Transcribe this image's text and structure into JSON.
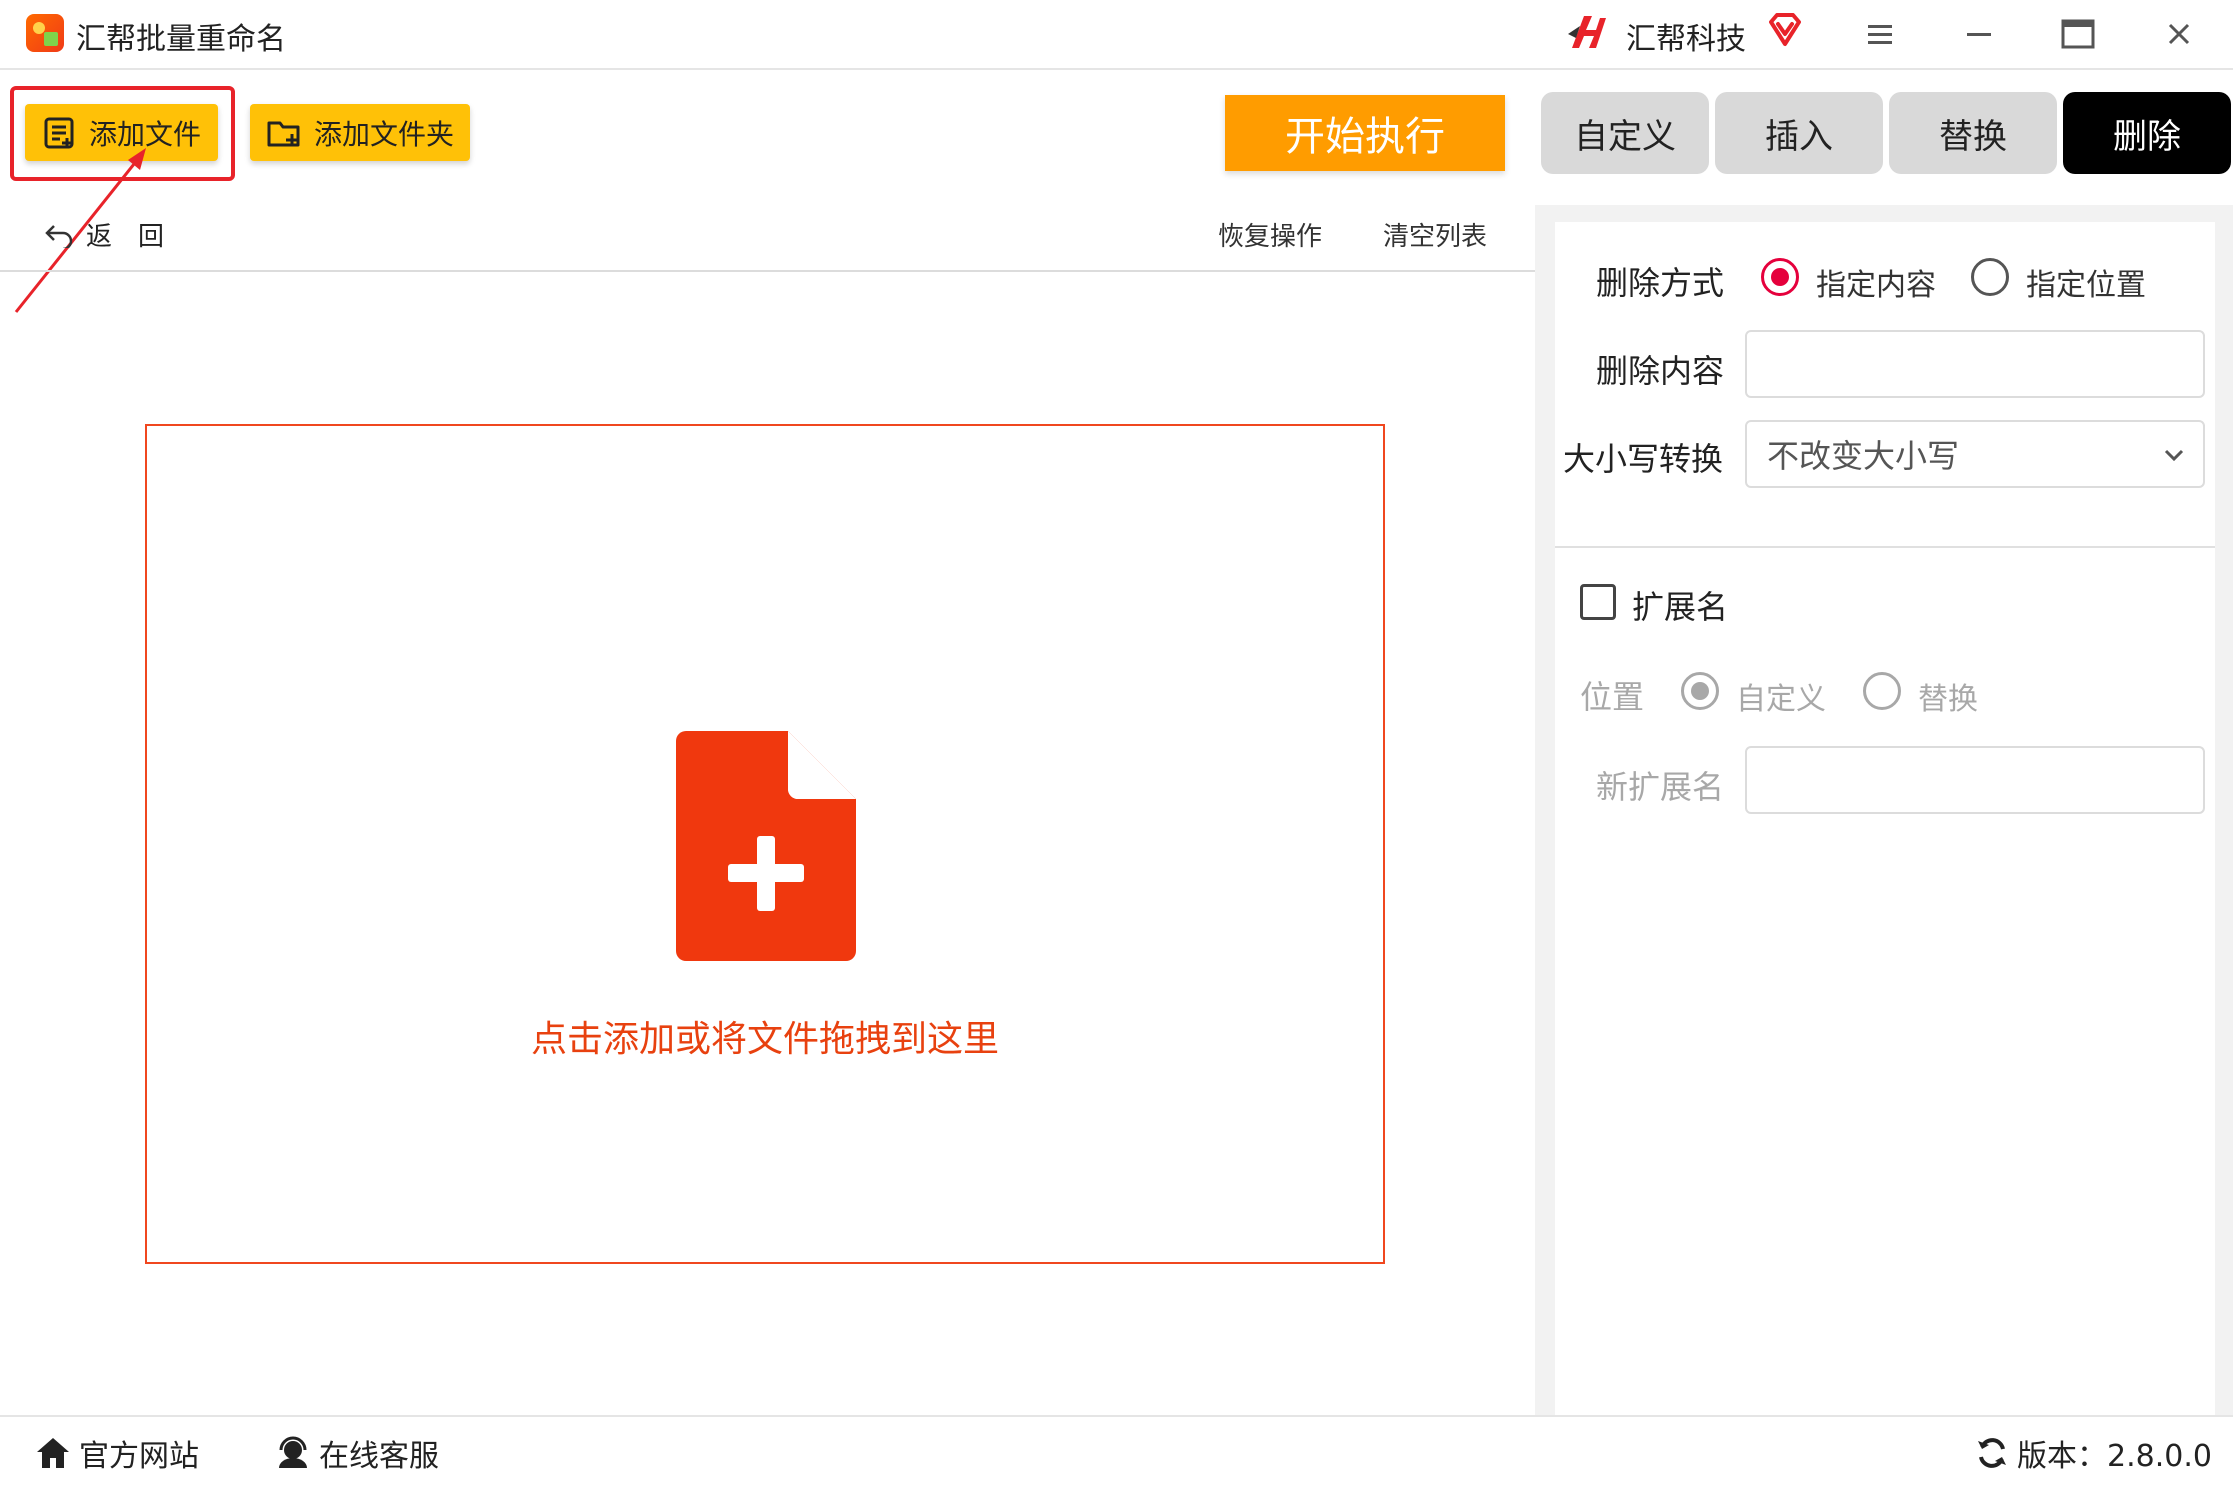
{
  "app": {
    "title": "汇帮批量重命名",
    "brand": "汇帮科技"
  },
  "toolbar": {
    "add_file": "添加文件",
    "add_folder": "添加文件夹",
    "start": "开始执行"
  },
  "tabs": [
    {
      "label": "自定义",
      "active": false
    },
    {
      "label": "插入",
      "active": false
    },
    {
      "label": "替换",
      "active": false
    },
    {
      "label": "删除",
      "active": true
    }
  ],
  "list": {
    "back": "返　回",
    "restore": "恢复操作",
    "clear": "清空列表"
  },
  "dropzone": {
    "hint": "点击添加或将文件拖拽到这里"
  },
  "delete_panel": {
    "method_label": "删除方式",
    "method_options": [
      "指定内容",
      "指定位置"
    ],
    "method_selected": "指定内容",
    "content_label": "删除内容",
    "content_value": "",
    "case_label": "大小写转换",
    "case_value": "不改变大小写"
  },
  "extension": {
    "checkbox_label": "扩展名",
    "checked": false,
    "position_label": "位置",
    "position_options": [
      "自定义",
      "替换"
    ],
    "position_selected": "自定义",
    "new_ext_label": "新扩展名",
    "new_ext_value": ""
  },
  "status": {
    "website": "官方网站",
    "service": "在线客服",
    "version": "版本：2.8.0.0"
  },
  "colors": {
    "accent_yellow": "#ffc107",
    "start_orange": "#ff9c00",
    "drop_red": "#f0471f",
    "radio_red": "#e5003c",
    "active_tab": "#000000"
  },
  "icons": {
    "app": "app-logo-icon",
    "brand": "brand-logo-icon",
    "vip": "vip-diamond-icon",
    "menu": "hamburger-icon",
    "minimize": "minimize-icon",
    "maximize": "maximize-icon",
    "close": "close-icon",
    "add_file": "file-list-icon",
    "add_folder": "folder-add-icon",
    "back": "undo-arrow-icon",
    "drop": "file-add-icon",
    "select": "chevron-down-icon",
    "website": "home-icon",
    "service": "headset-icon",
    "version": "refresh-icon"
  }
}
